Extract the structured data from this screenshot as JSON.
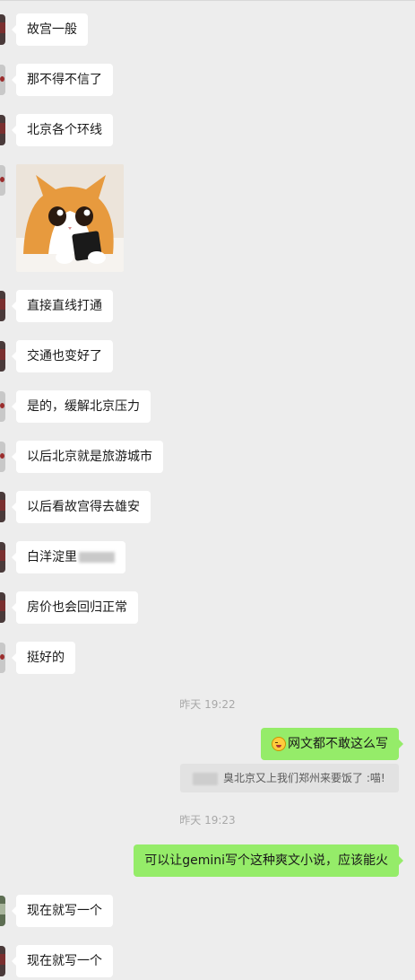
{
  "messages": [
    {
      "text": "故宫一般"
    },
    {
      "text": "那不得不信了"
    },
    {
      "text": "北京各个环线"
    },
    {
      "sticker": "cat-holding-phone"
    },
    {
      "text": "直接直线打通"
    },
    {
      "text": "交通也变好了"
    },
    {
      "text": "是的，缓解北京压力"
    },
    {
      "text": "以后北京就是旅游城市"
    },
    {
      "text": "以后看故宫得去雄安"
    },
    {
      "text": "白洋淀里"
    },
    {
      "text": "房价也会回归正常"
    },
    {
      "text": "挺好的"
    }
  ],
  "timestamps": [
    "昨天 19:22",
    "昨天 19:23"
  ],
  "sent": [
    {
      "text": "网文都不敢这么写",
      "emoji": "grin-squint-emoji"
    },
    {
      "text": "可以让gemini写个这种爽文小说，应该能火"
    }
  ],
  "quote": {
    "text": "臭北京又上我们郑州来要饭了 :喵!"
  },
  "replies": [
    {
      "text": "现在就写一个"
    },
    {
      "text": "现在就写一个"
    }
  ],
  "colors": {
    "background": "#ededed",
    "received_bubble": "#ffffff",
    "sent_bubble": "#95ec69"
  }
}
